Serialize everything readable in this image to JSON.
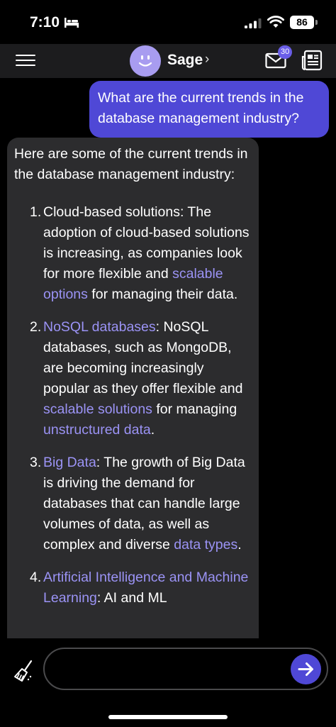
{
  "status_bar": {
    "time": "7:10",
    "battery": "86",
    "icons": [
      "bed-icon",
      "signal-icon",
      "wifi-icon"
    ]
  },
  "header": {
    "bot_name": "Sage",
    "chevron": "›",
    "inbox_badge": "30",
    "icons": [
      "menu-icon",
      "bot-avatar",
      "inbox-icon",
      "news-icon"
    ]
  },
  "chat": {
    "user_message": "What are the current trends in the database management industry?",
    "bot_message": {
      "intro": "Here are some of the current trends in the database management industry:",
      "items": [
        {
          "num": "1.",
          "segments": [
            {
              "text": "Cloud-based solutions: The adoption of cloud-based solutions is increasing, as companies look for more flexible and "
            },
            {
              "text": "scalable options",
              "link": true
            },
            {
              "text": " for managing their data."
            }
          ]
        },
        {
          "num": "2.",
          "segments": [
            {
              "text": "NoSQL databases",
              "link": true
            },
            {
              "text": ": NoSQL databases, such as MongoDB, are becoming increasingly popular as they offer flexible and "
            },
            {
              "text": "scalable solutions",
              "link": true
            },
            {
              "text": " for managing "
            },
            {
              "text": "unstructured data",
              "link": true
            },
            {
              "text": "."
            }
          ]
        },
        {
          "num": "3.",
          "segments": [
            {
              "text": "Big Data",
              "link": true
            },
            {
              "text": ": The growth of Big Data is driving the demand for databases that can handle large volumes of data, as well as complex and diverse "
            },
            {
              "text": "data types",
              "link": true
            },
            {
              "text": "."
            }
          ]
        },
        {
          "num": "4.",
          "segments": [
            {
              "text": "Artificial Intelligence and Machine Learning",
              "link": true
            },
            {
              "text": ": AI and ML"
            }
          ]
        }
      ]
    }
  },
  "composer": {
    "placeholder": "",
    "icons": [
      "broom-icon",
      "send-arrow-icon"
    ]
  },
  "colors": {
    "accent": "#4f48d6",
    "link": "#9b93f5",
    "bubble": "#2c2c2e",
    "header": "#1c1c1e",
    "avatar": "#a89cf0"
  }
}
